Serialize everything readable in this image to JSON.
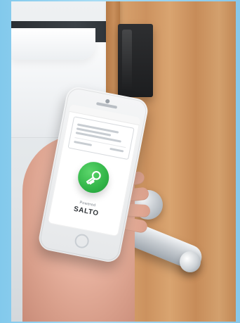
{
  "image": {
    "width": 342,
    "height": 459
  },
  "phone_ui": {
    "key_button_label": "",
    "powered_text": "Powered",
    "brand_text": "SALTO"
  },
  "colors": {
    "frame_blue": "#8fd0ef",
    "wood": "#d6a06c",
    "key_green": "#34b74a"
  }
}
